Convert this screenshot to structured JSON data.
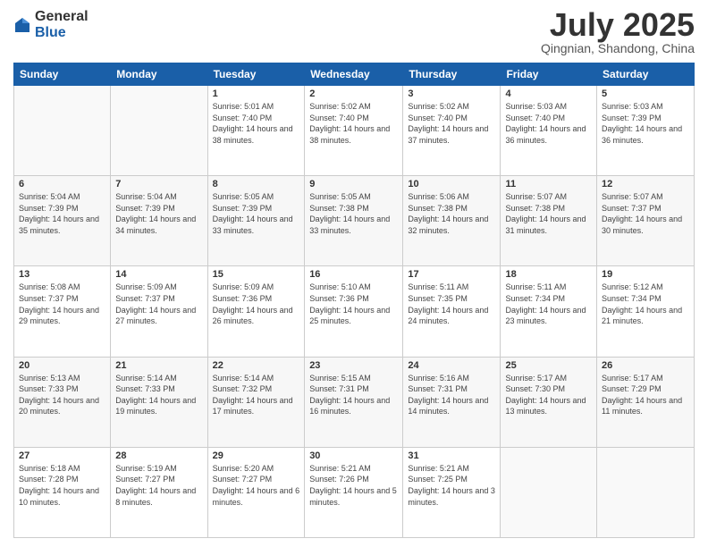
{
  "header": {
    "logo_general": "General",
    "logo_blue": "Blue",
    "month_title": "July 2025",
    "location": "Qingnian, Shandong, China"
  },
  "days_of_week": [
    "Sunday",
    "Monday",
    "Tuesday",
    "Wednesday",
    "Thursday",
    "Friday",
    "Saturday"
  ],
  "weeks": [
    [
      {
        "day": "",
        "info": ""
      },
      {
        "day": "",
        "info": ""
      },
      {
        "day": "1",
        "info": "Sunrise: 5:01 AM\nSunset: 7:40 PM\nDaylight: 14 hours and 38 minutes."
      },
      {
        "day": "2",
        "info": "Sunrise: 5:02 AM\nSunset: 7:40 PM\nDaylight: 14 hours and 38 minutes."
      },
      {
        "day": "3",
        "info": "Sunrise: 5:02 AM\nSunset: 7:40 PM\nDaylight: 14 hours and 37 minutes."
      },
      {
        "day": "4",
        "info": "Sunrise: 5:03 AM\nSunset: 7:40 PM\nDaylight: 14 hours and 36 minutes."
      },
      {
        "day": "5",
        "info": "Sunrise: 5:03 AM\nSunset: 7:39 PM\nDaylight: 14 hours and 36 minutes."
      }
    ],
    [
      {
        "day": "6",
        "info": "Sunrise: 5:04 AM\nSunset: 7:39 PM\nDaylight: 14 hours and 35 minutes."
      },
      {
        "day": "7",
        "info": "Sunrise: 5:04 AM\nSunset: 7:39 PM\nDaylight: 14 hours and 34 minutes."
      },
      {
        "day": "8",
        "info": "Sunrise: 5:05 AM\nSunset: 7:39 PM\nDaylight: 14 hours and 33 minutes."
      },
      {
        "day": "9",
        "info": "Sunrise: 5:05 AM\nSunset: 7:38 PM\nDaylight: 14 hours and 33 minutes."
      },
      {
        "day": "10",
        "info": "Sunrise: 5:06 AM\nSunset: 7:38 PM\nDaylight: 14 hours and 32 minutes."
      },
      {
        "day": "11",
        "info": "Sunrise: 5:07 AM\nSunset: 7:38 PM\nDaylight: 14 hours and 31 minutes."
      },
      {
        "day": "12",
        "info": "Sunrise: 5:07 AM\nSunset: 7:37 PM\nDaylight: 14 hours and 30 minutes."
      }
    ],
    [
      {
        "day": "13",
        "info": "Sunrise: 5:08 AM\nSunset: 7:37 PM\nDaylight: 14 hours and 29 minutes."
      },
      {
        "day": "14",
        "info": "Sunrise: 5:09 AM\nSunset: 7:37 PM\nDaylight: 14 hours and 27 minutes."
      },
      {
        "day": "15",
        "info": "Sunrise: 5:09 AM\nSunset: 7:36 PM\nDaylight: 14 hours and 26 minutes."
      },
      {
        "day": "16",
        "info": "Sunrise: 5:10 AM\nSunset: 7:36 PM\nDaylight: 14 hours and 25 minutes."
      },
      {
        "day": "17",
        "info": "Sunrise: 5:11 AM\nSunset: 7:35 PM\nDaylight: 14 hours and 24 minutes."
      },
      {
        "day": "18",
        "info": "Sunrise: 5:11 AM\nSunset: 7:34 PM\nDaylight: 14 hours and 23 minutes."
      },
      {
        "day": "19",
        "info": "Sunrise: 5:12 AM\nSunset: 7:34 PM\nDaylight: 14 hours and 21 minutes."
      }
    ],
    [
      {
        "day": "20",
        "info": "Sunrise: 5:13 AM\nSunset: 7:33 PM\nDaylight: 14 hours and 20 minutes."
      },
      {
        "day": "21",
        "info": "Sunrise: 5:14 AM\nSunset: 7:33 PM\nDaylight: 14 hours and 19 minutes."
      },
      {
        "day": "22",
        "info": "Sunrise: 5:14 AM\nSunset: 7:32 PM\nDaylight: 14 hours and 17 minutes."
      },
      {
        "day": "23",
        "info": "Sunrise: 5:15 AM\nSunset: 7:31 PM\nDaylight: 14 hours and 16 minutes."
      },
      {
        "day": "24",
        "info": "Sunrise: 5:16 AM\nSunset: 7:31 PM\nDaylight: 14 hours and 14 minutes."
      },
      {
        "day": "25",
        "info": "Sunrise: 5:17 AM\nSunset: 7:30 PM\nDaylight: 14 hours and 13 minutes."
      },
      {
        "day": "26",
        "info": "Sunrise: 5:17 AM\nSunset: 7:29 PM\nDaylight: 14 hours and 11 minutes."
      }
    ],
    [
      {
        "day": "27",
        "info": "Sunrise: 5:18 AM\nSunset: 7:28 PM\nDaylight: 14 hours and 10 minutes."
      },
      {
        "day": "28",
        "info": "Sunrise: 5:19 AM\nSunset: 7:27 PM\nDaylight: 14 hours and 8 minutes."
      },
      {
        "day": "29",
        "info": "Sunrise: 5:20 AM\nSunset: 7:27 PM\nDaylight: 14 hours and 6 minutes."
      },
      {
        "day": "30",
        "info": "Sunrise: 5:21 AM\nSunset: 7:26 PM\nDaylight: 14 hours and 5 minutes."
      },
      {
        "day": "31",
        "info": "Sunrise: 5:21 AM\nSunset: 7:25 PM\nDaylight: 14 hours and 3 minutes."
      },
      {
        "day": "",
        "info": ""
      },
      {
        "day": "",
        "info": ""
      }
    ]
  ]
}
